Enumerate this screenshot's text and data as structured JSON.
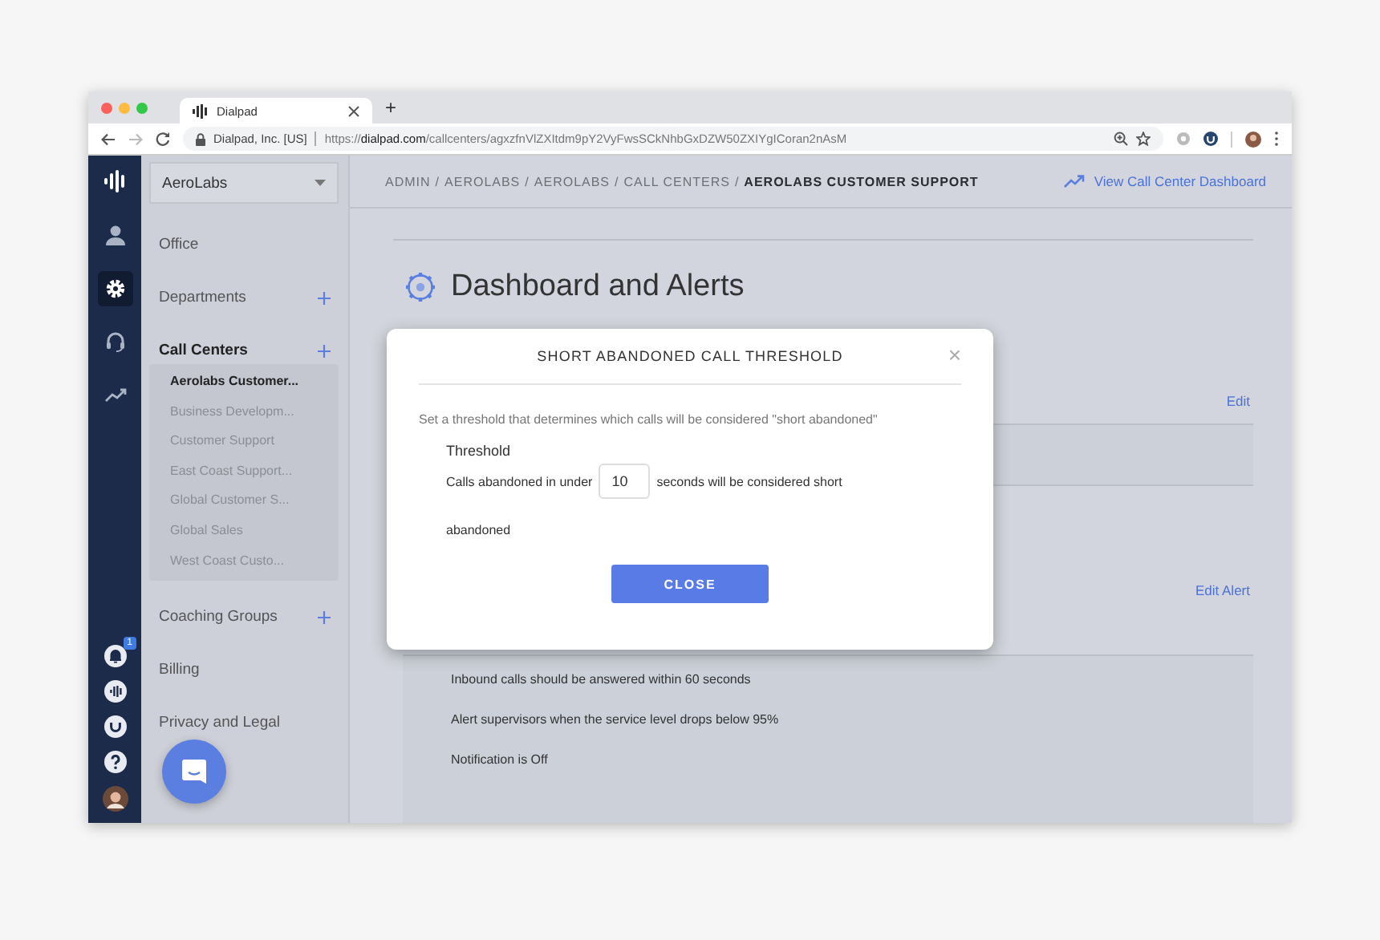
{
  "browser": {
    "tab_title": "Dialpad",
    "new_tab": "+",
    "site_label": "Dialpad, Inc. [US]",
    "url": {
      "scheme": "https://",
      "domain": "dialpad.com",
      "path": "/callcenters/agxzfnVlZXItdm9pY2VyFwsSCkNhbGxDZW50ZXIYgICoran2nAsM"
    }
  },
  "rail": {
    "top": [
      {
        "kind": "person",
        "selected": false
      },
      {
        "kind": "gear",
        "selected": true
      },
      {
        "kind": "headset",
        "selected": false
      },
      {
        "kind": "trend",
        "selected": false
      }
    ],
    "bottom": [
      {
        "kind": "bell",
        "badge": "1"
      },
      {
        "kind": "wave"
      },
      {
        "kind": "smile"
      },
      {
        "kind": "help"
      },
      {
        "kind": "avatar"
      }
    ]
  },
  "sidebar": {
    "org_select": "AeroLabs",
    "sections": [
      {
        "label": "Office",
        "selected": false,
        "can_add": false
      },
      {
        "label": "Departments",
        "selected": false,
        "can_add": true
      },
      {
        "label": "Call Centers",
        "selected": true,
        "can_add": true,
        "children": [
          {
            "label": "Aerolabs Customer...",
            "selected": true
          },
          {
            "label": "Business Developm...",
            "selected": false
          },
          {
            "label": "Customer Support",
            "selected": false
          },
          {
            "label": "East Coast Support...",
            "selected": false
          },
          {
            "label": "Global Customer S...",
            "selected": false
          },
          {
            "label": "Global Sales",
            "selected": false
          },
          {
            "label": "West Coast Custo...",
            "selected": false
          }
        ]
      },
      {
        "label": "Coaching Groups",
        "selected": false,
        "can_add": true
      },
      {
        "label": "Billing",
        "selected": false,
        "can_add": false
      },
      {
        "label": "Privacy and Legal",
        "selected": false,
        "can_add": false
      }
    ]
  },
  "breadcrumb": {
    "separator": "/",
    "items": [
      "ADMIN",
      "AEROLABS",
      "AEROLABS",
      "CALL CENTERS",
      "AEROLABS CUSTOMER SUPPORT"
    ]
  },
  "dashboard_link": "View Call Center Dashboard",
  "page_title": "Dashboard and Alerts",
  "edit_link": "Edit",
  "edit_alert_link": "Edit Alert",
  "service_level": [
    "Inbound calls should be answered within 60 seconds",
    "Alert supervisors when the service level drops below 95%",
    "Notification is Off"
  ],
  "modal": {
    "title": "SHORT ABANDONED CALL THRESHOLD",
    "close": "×",
    "description": "Set a threshold that determines which calls will be considered \"short abandoned\"",
    "field_label": "Threshold",
    "before_value": "Calls abandoned in under",
    "value": "10",
    "after_value": "seconds will be considered short",
    "continuation": "abandoned",
    "button": "CLOSE"
  }
}
